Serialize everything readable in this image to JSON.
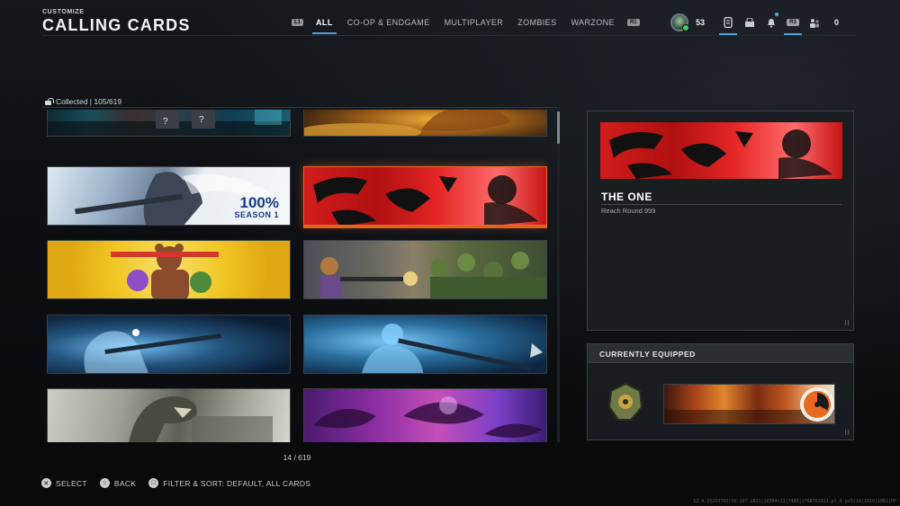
{
  "header": {
    "breadcrumb": "CUSTOMIZE",
    "title": "CALLING CARDS",
    "left_bumper": "L1",
    "right_bumper": "R1",
    "tabs": [
      {
        "label": "ALL",
        "active": true
      },
      {
        "label": "CO-OP & ENDGAME",
        "active": false
      },
      {
        "label": "MULTIPLAYER",
        "active": false
      },
      {
        "label": "ZOMBIES",
        "active": false
      },
      {
        "label": "WARZONE",
        "active": false
      }
    ],
    "player_level": "53",
    "r3_label": "R3",
    "party_count": "0"
  },
  "grid": {
    "collected_label": "Collected | 105/619",
    "season_card": {
      "percent": "100%",
      "season": "SEASON 1"
    },
    "pager": "14 / 619"
  },
  "preview": {
    "name": "THE ONE",
    "description": "Reach Round 999"
  },
  "equipped": {
    "title": "CURRENTLY EQUIPPED"
  },
  "footer": {
    "select_label": "SELECT",
    "back_label": "BACK",
    "filter_label": "FILTER & SORT: DEFAULT, ALL CARDS"
  },
  "version_text": "12.4.25253765|56-107.1021|10364+11|7400|1768762811.pl.6.ps5|18|1910|1082|PP",
  "colors": {
    "accent_blue": "#4aa3d8",
    "selection_orange": "#e0621d",
    "panel_bg": "#1a1e22"
  }
}
